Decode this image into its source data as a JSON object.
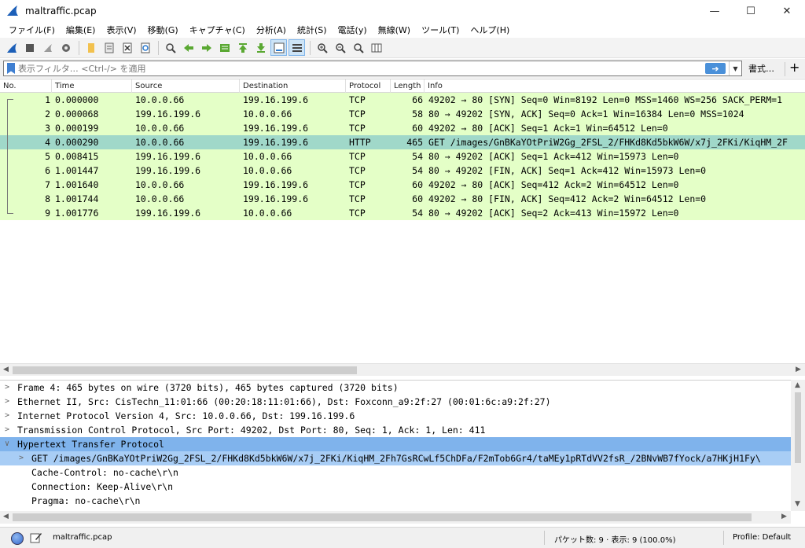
{
  "window": {
    "title": "maltraffic.pcap"
  },
  "menu": [
    "ファイル(F)",
    "編集(E)",
    "表示(V)",
    "移動(G)",
    "キャプチャ(C)",
    "分析(A)",
    "統計(S)",
    "電話(y)",
    "無線(W)",
    "ツール(T)",
    "ヘルプ(H)"
  ],
  "filter": {
    "placeholder": "表示フィルタ… <Ctrl-/> を適用",
    "expression_label": "書式…",
    "add_label": "+"
  },
  "columns": [
    "No.",
    "Time",
    "Source",
    "Destination",
    "Protocol",
    "Length",
    "Info"
  ],
  "packets": [
    {
      "no": "1",
      "time": "0.000000",
      "src": "10.0.0.66",
      "dst": "199.16.199.6",
      "proto": "TCP",
      "len": "66",
      "info": "49202 → 80 [SYN] Seq=0 Win=8192 Len=0 MSS=1460 WS=256 SACK_PERM=1"
    },
    {
      "no": "2",
      "time": "0.000068",
      "src": "199.16.199.6",
      "dst": "10.0.0.66",
      "proto": "TCP",
      "len": "58",
      "info": "80 → 49202 [SYN, ACK] Seq=0 Ack=1 Win=16384 Len=0 MSS=1024"
    },
    {
      "no": "3",
      "time": "0.000199",
      "src": "10.0.0.66",
      "dst": "199.16.199.6",
      "proto": "TCP",
      "len": "60",
      "info": "49202 → 80 [ACK] Seq=1 Ack=1 Win=64512 Len=0"
    },
    {
      "no": "4",
      "time": "0.000290",
      "src": "10.0.0.66",
      "dst": "199.16.199.6",
      "proto": "HTTP",
      "len": "465",
      "info": "GET /images/GnBKaYOtPriW2Gg_2FSL_2/FHKd8Kd5bkW6W/x7j_2FKi/KiqHM_2F"
    },
    {
      "no": "5",
      "time": "0.008415",
      "src": "199.16.199.6",
      "dst": "10.0.0.66",
      "proto": "TCP",
      "len": "54",
      "info": "80 → 49202 [ACK] Seq=1 Ack=412 Win=15973 Len=0"
    },
    {
      "no": "6",
      "time": "1.001447",
      "src": "199.16.199.6",
      "dst": "10.0.0.66",
      "proto": "TCP",
      "len": "54",
      "info": "80 → 49202 [FIN, ACK] Seq=1 Ack=412 Win=15973 Len=0"
    },
    {
      "no": "7",
      "time": "1.001640",
      "src": "10.0.0.66",
      "dst": "199.16.199.6",
      "proto": "TCP",
      "len": "60",
      "info": "49202 → 80 [ACK] Seq=412 Ack=2 Win=64512 Len=0"
    },
    {
      "no": "8",
      "time": "1.001744",
      "src": "10.0.0.66",
      "dst": "199.16.199.6",
      "proto": "TCP",
      "len": "60",
      "info": "49202 → 80 [FIN, ACK] Seq=412 Ack=2 Win=64512 Len=0"
    },
    {
      "no": "9",
      "time": "1.001776",
      "src": "199.16.199.6",
      "dst": "10.0.0.66",
      "proto": "TCP",
      "len": "54",
      "info": "80 → 49202 [ACK] Seq=2 Ack=413 Win=15972 Len=0"
    }
  ],
  "selected_packet": "4",
  "details": [
    {
      "text": "Frame 4: 465 bytes on wire (3720 bits), 465 bytes captured (3720 bits)",
      "expander": ">",
      "indent": 0,
      "state": ""
    },
    {
      "text": "Ethernet II, Src: CisTechn_11:01:66 (00:20:18:11:01:66), Dst: Foxconn_a9:2f:27 (00:01:6c:a9:2f:27)",
      "expander": ">",
      "indent": 0,
      "state": ""
    },
    {
      "text": "Internet Protocol Version 4, Src: 10.0.0.66, Dst: 199.16.199.6",
      "expander": ">",
      "indent": 0,
      "state": ""
    },
    {
      "text": "Transmission Control Protocol, Src Port: 49202, Dst Port: 80, Seq: 1, Ack: 1, Len: 411",
      "expander": ">",
      "indent": 0,
      "state": ""
    },
    {
      "text": "Hypertext Transfer Protocol",
      "expander": "∨",
      "indent": 0,
      "state": "hl"
    },
    {
      "text": "GET /images/GnBKaYOtPriW2Gg_2FSL_2/FHKd8Kd5bkW6W/x7j_2FKi/KiqHM_2Fh7GsRCwLf5ChDFa/F2mTob6Gr4/taMEy1pRTdVV2fsR_/2BNvWB7fYock/a7HKjH1Fy\\",
      "expander": ">",
      "indent": 1,
      "state": "hl2"
    },
    {
      "text": "Cache-Control: no-cache\\r\\n",
      "expander": "",
      "indent": 1,
      "state": ""
    },
    {
      "text": "Connection: Keep-Alive\\r\\n",
      "expander": "",
      "indent": 1,
      "state": ""
    },
    {
      "text": "Pragma: no-cache\\r\\n",
      "expander": "",
      "indent": 1,
      "state": ""
    }
  ],
  "status": {
    "file": "maltraffic.pcap",
    "packets": "パケット数: 9 · 表示: 9 (100.0%)",
    "profile": "Profile: Default"
  },
  "colors": {
    "tcp_row": "#e4ffc7",
    "selected_row": "#a0d8c9",
    "detail_highlight": "#7fb3ec"
  }
}
